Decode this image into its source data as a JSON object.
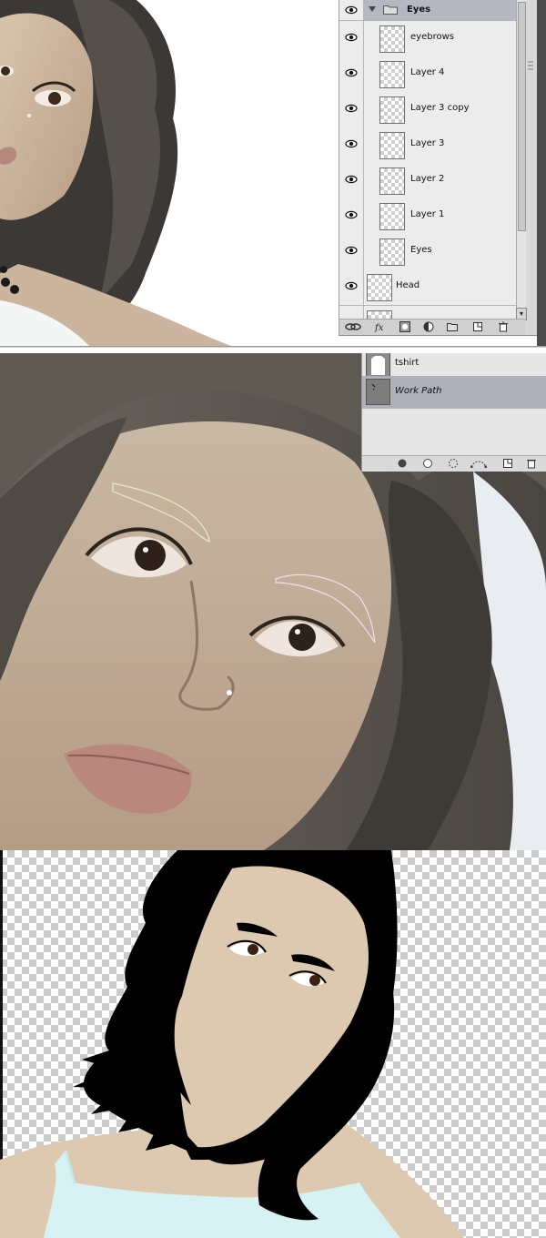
{
  "layers_panel": {
    "group": {
      "name": "Eyes"
    },
    "layers": [
      {
        "name": "eyebrows"
      },
      {
        "name": "Layer 4"
      },
      {
        "name": "Layer 3 copy"
      },
      {
        "name": "Layer 3"
      },
      {
        "name": "Layer 2"
      },
      {
        "name": "Layer 1"
      },
      {
        "name": "Eyes"
      }
    ],
    "head_layer": {
      "name": "Head"
    },
    "toolbar_icons": [
      "link-icon",
      "fx-icon",
      "mask-icon",
      "adjustment-icon",
      "folder-icon",
      "new-layer-icon",
      "trash-icon"
    ]
  },
  "paths_panel": {
    "rows": [
      {
        "name": "tshirt",
        "italic": false
      },
      {
        "name": "Work Path",
        "italic": true
      }
    ],
    "toolbar_icons": [
      "fill-path-icon",
      "stroke-path-icon",
      "load-selection-icon",
      "make-path-icon",
      "new-path-icon",
      "trash-icon"
    ]
  },
  "colors": {
    "panel_bg": "#ececec",
    "selected_row": "#b5b7c2",
    "skin": "#dcc9b0",
    "hair": "#000000",
    "shirt": "#d6f2f2",
    "path_stroke": "#e8f0c0"
  }
}
